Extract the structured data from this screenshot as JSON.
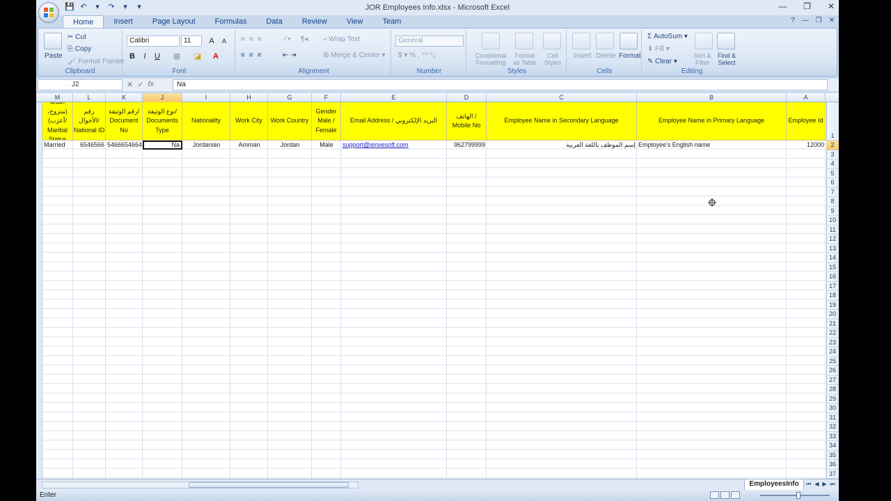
{
  "window": {
    "title": "JOR Employees Info.xlsx - Microsoft Excel",
    "controls": [
      "—",
      "❐",
      "✕"
    ]
  },
  "qat": [
    "💾",
    "↶",
    "▾",
    "↷",
    "▾",
    "▾"
  ],
  "tabs": [
    "Home",
    "Insert",
    "Page Layout",
    "Formulas",
    "Data",
    "Review",
    "View",
    "Team"
  ],
  "ribbon": {
    "clipboard": {
      "paste": "Paste",
      "cut": "Cut",
      "copy": "Copy",
      "format_painter": "Format Painter",
      "label": "Clipboard"
    },
    "font": {
      "name": "Calibri",
      "size": "11",
      "bold": "B",
      "italic": "I",
      "underline": "U",
      "label": "Font"
    },
    "alignment": {
      "wrap_text": "Wrap Text",
      "merge_center": "Merge & Center",
      "label": "Alignment"
    },
    "number": {
      "format": "General",
      "label": "Number"
    },
    "styles": {
      "conditional": "Conditional Formatting",
      "format_table": "Format as Table",
      "cell_styles": "Cell Styles",
      "label": "Styles"
    },
    "cells": {
      "insert": "Insert",
      "delete": "Delete",
      "format": "Format",
      "label": "Cells"
    },
    "editing": {
      "autosum": "AutoSum",
      "fill": "Fill",
      "clear": "Clear",
      "sort_filter": "Sort & Filter",
      "find_select": "Find & Select",
      "label": "Editing"
    }
  },
  "formula_bar": {
    "name_box": "J2",
    "content": "Na"
  },
  "columns": [
    "M",
    "L",
    "K",
    "J",
    "I",
    "H",
    "G",
    "F",
    "E",
    "D",
    "C",
    "B",
    "A"
  ],
  "selected_column": "J",
  "header_row": [
    "الحالة (متزوج، أعزب)/ Maritial Status",
    "رقم الأحوال/ National ID",
    "رقم الوثيقة/ Document No",
    "نوع الوثيقة/ Documents Type",
    "Nationality",
    "Work City",
    "Work Country",
    "Gender Male / Female",
    "Email Address / البريد الإلكتروني",
    "الهاتف / Mobile No",
    "Employee Name in Secondary Language",
    "Employee Name in Primary Language",
    "Employee Id"
  ],
  "data_row": [
    "Married",
    "6546566",
    "5466654664",
    "Na",
    "Jordanian",
    "Amman",
    "Jordan",
    "Male",
    "support@ienvesoft.com",
    "962799999",
    "إسم الموظف باللغة العربية",
    "Employee's English name",
    "12000"
  ],
  "row_numbers": [
    "1",
    "2",
    "3",
    "4",
    "5",
    "6",
    "7",
    "8",
    "9",
    "10",
    "11",
    "12",
    "13",
    "14",
    "15",
    "16",
    "17",
    "18",
    "19",
    "20",
    "21",
    "22",
    "23",
    "24",
    "25",
    "26",
    "27",
    "28",
    "29",
    "30",
    "31",
    "32",
    "33",
    "34",
    "35",
    "36",
    "37"
  ],
  "selected_row": "2",
  "sheet_tab": "EmployeesInfo",
  "status": "Enter",
  "colors": {
    "header_fill": "#ffff00",
    "selection": "#f6c76a",
    "ribbon": "#dae6f4"
  }
}
